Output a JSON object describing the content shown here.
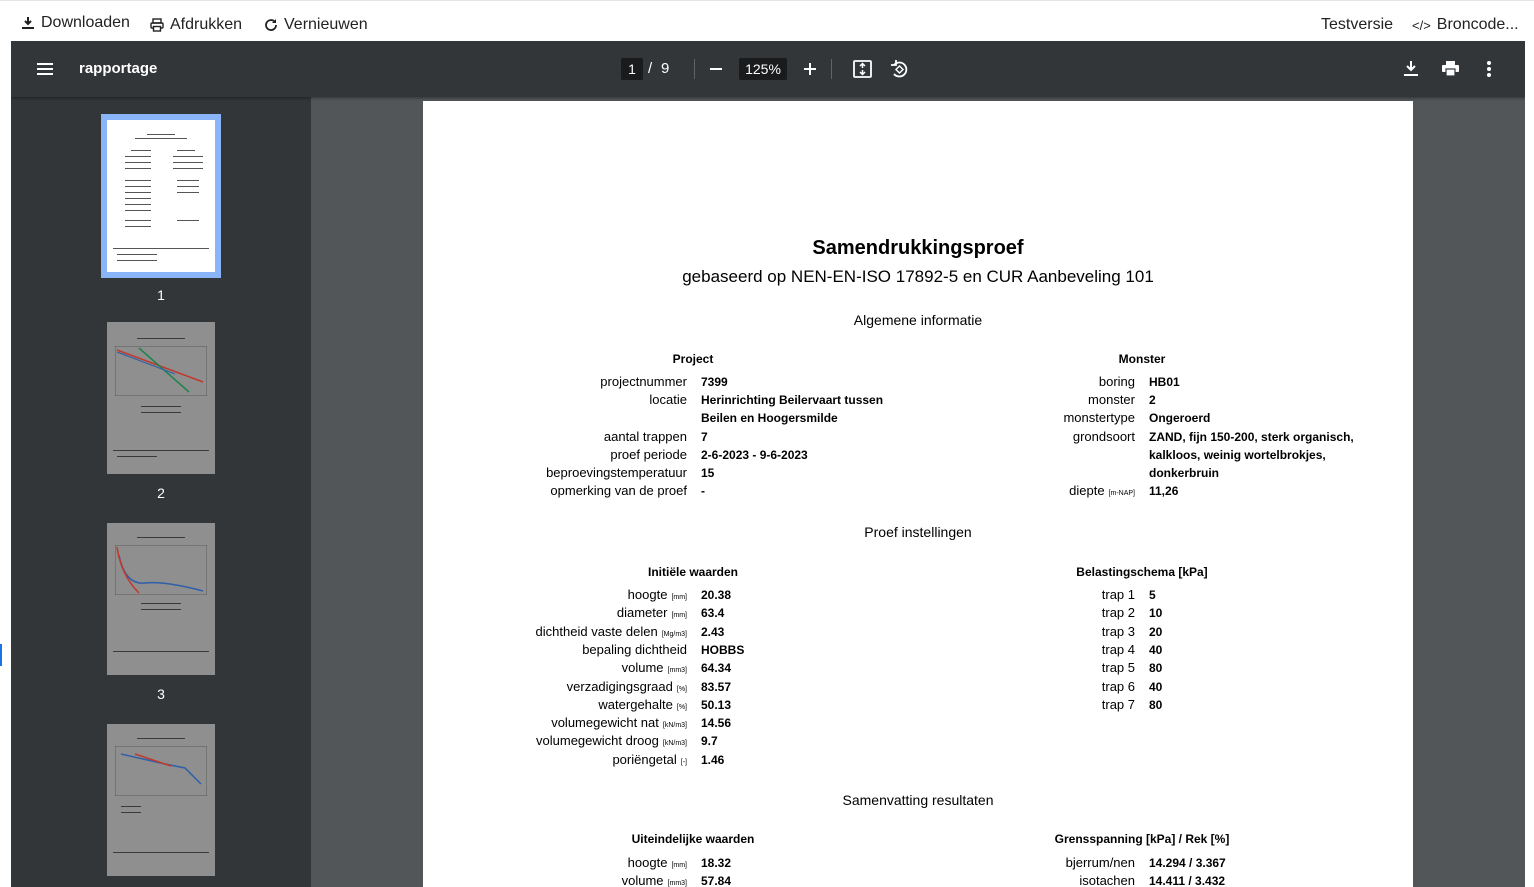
{
  "topbar": {
    "download": "Downloaden",
    "print": "Afdrukken",
    "refresh": "Vernieuwen",
    "test": "Testversie",
    "source": "Broncode..."
  },
  "viewer": {
    "title": "rapportage",
    "page_current": "1",
    "page_sep": "/",
    "page_total": "9",
    "zoom": "125%"
  },
  "thumbnails": [
    "1",
    "2",
    "3"
  ],
  "doc": {
    "title": "Samendrukkingsproef",
    "subtitle": "gebaseerd op NEN-EN-ISO 17892-5 en CUR Aanbeveling 101",
    "section_general": "Algemene informatie",
    "project_header": "Project",
    "monster_header": "Monster",
    "project": [
      {
        "label": "projectnummer",
        "value": "7399"
      },
      {
        "label": "locatie",
        "value": "Herinrichting Beilervaart tussen"
      },
      {
        "label": "",
        "value": "Beilen en Hoogersmilde"
      },
      {
        "label": "aantal trappen",
        "value": "7"
      },
      {
        "label": "proef periode",
        "value": "2-6-2023 - 9-6-2023"
      },
      {
        "label": "beproevingstemperatuur",
        "value": "15"
      },
      {
        "label": "opmerking van de proef",
        "value": "-"
      }
    ],
    "monster": [
      {
        "label": "boring",
        "value": "HB01"
      },
      {
        "label": "monster",
        "value": "2"
      },
      {
        "label": "monstertype",
        "value": "Ongeroerd"
      },
      {
        "label": "grondsoort",
        "value": "ZAND, fijn 150-200, sterk organisch,"
      },
      {
        "label": "",
        "value": "kalkloos, weinig wortelbrokjes,"
      },
      {
        "label": "",
        "value": "donkerbruin"
      },
      {
        "label": "diepte",
        "unit": "[m-NAP]",
        "value": "11,26"
      }
    ],
    "section_settings": "Proef instellingen",
    "initial_header": "Initiële waarden",
    "load_header": "Belastingschema [kPa]",
    "initial": [
      {
        "label": "hoogte",
        "unit": "[mm]",
        "value": "20.38"
      },
      {
        "label": "diameter",
        "unit": "[mm]",
        "value": "63.4"
      },
      {
        "label": "dichtheid vaste delen",
        "unit": "[Mg/m3]",
        "value": "2.43"
      },
      {
        "label": "bepaling dichtheid",
        "unit": "",
        "value": "HOBBS"
      },
      {
        "label": "volume",
        "unit": "[mm3]",
        "value": "64.34"
      },
      {
        "label": "verzadigingsgraad",
        "unit": "[%]",
        "value": "83.57"
      },
      {
        "label": "watergehalte",
        "unit": "[%]",
        "value": "50.13"
      },
      {
        "label": "volumegewicht nat",
        "unit": "[kN/m3]",
        "value": "14.56"
      },
      {
        "label": "volumegewicht droog",
        "unit": "[kN/m3]",
        "value": "9.7"
      },
      {
        "label": "poriëngetal",
        "unit": "[-]",
        "value": "1.46"
      }
    ],
    "load": [
      {
        "label": "trap 1",
        "value": "5"
      },
      {
        "label": "trap 2",
        "value": "10"
      },
      {
        "label": "trap 3",
        "value": "20"
      },
      {
        "label": "trap 4",
        "value": "40"
      },
      {
        "label": "trap 5",
        "value": "80"
      },
      {
        "label": "trap 6",
        "value": "40"
      },
      {
        "label": "trap 7",
        "value": "80"
      }
    ],
    "section_summary": "Samenvatting resultaten",
    "final_header": "Uiteindelijke waarden",
    "limit_header": "Grensspanning [kPa] / Rek [%]",
    "final": [
      {
        "label": "hoogte",
        "unit": "[mm]",
        "value": "18.32"
      },
      {
        "label": "volume",
        "unit": "[mm3]",
        "value": "57.84"
      }
    ],
    "limit": [
      {
        "label": "bjerrum/nen",
        "value": "14.294 / 3.367"
      },
      {
        "label": "isotachen",
        "value": "14.411 / 3.432"
      }
    ]
  }
}
